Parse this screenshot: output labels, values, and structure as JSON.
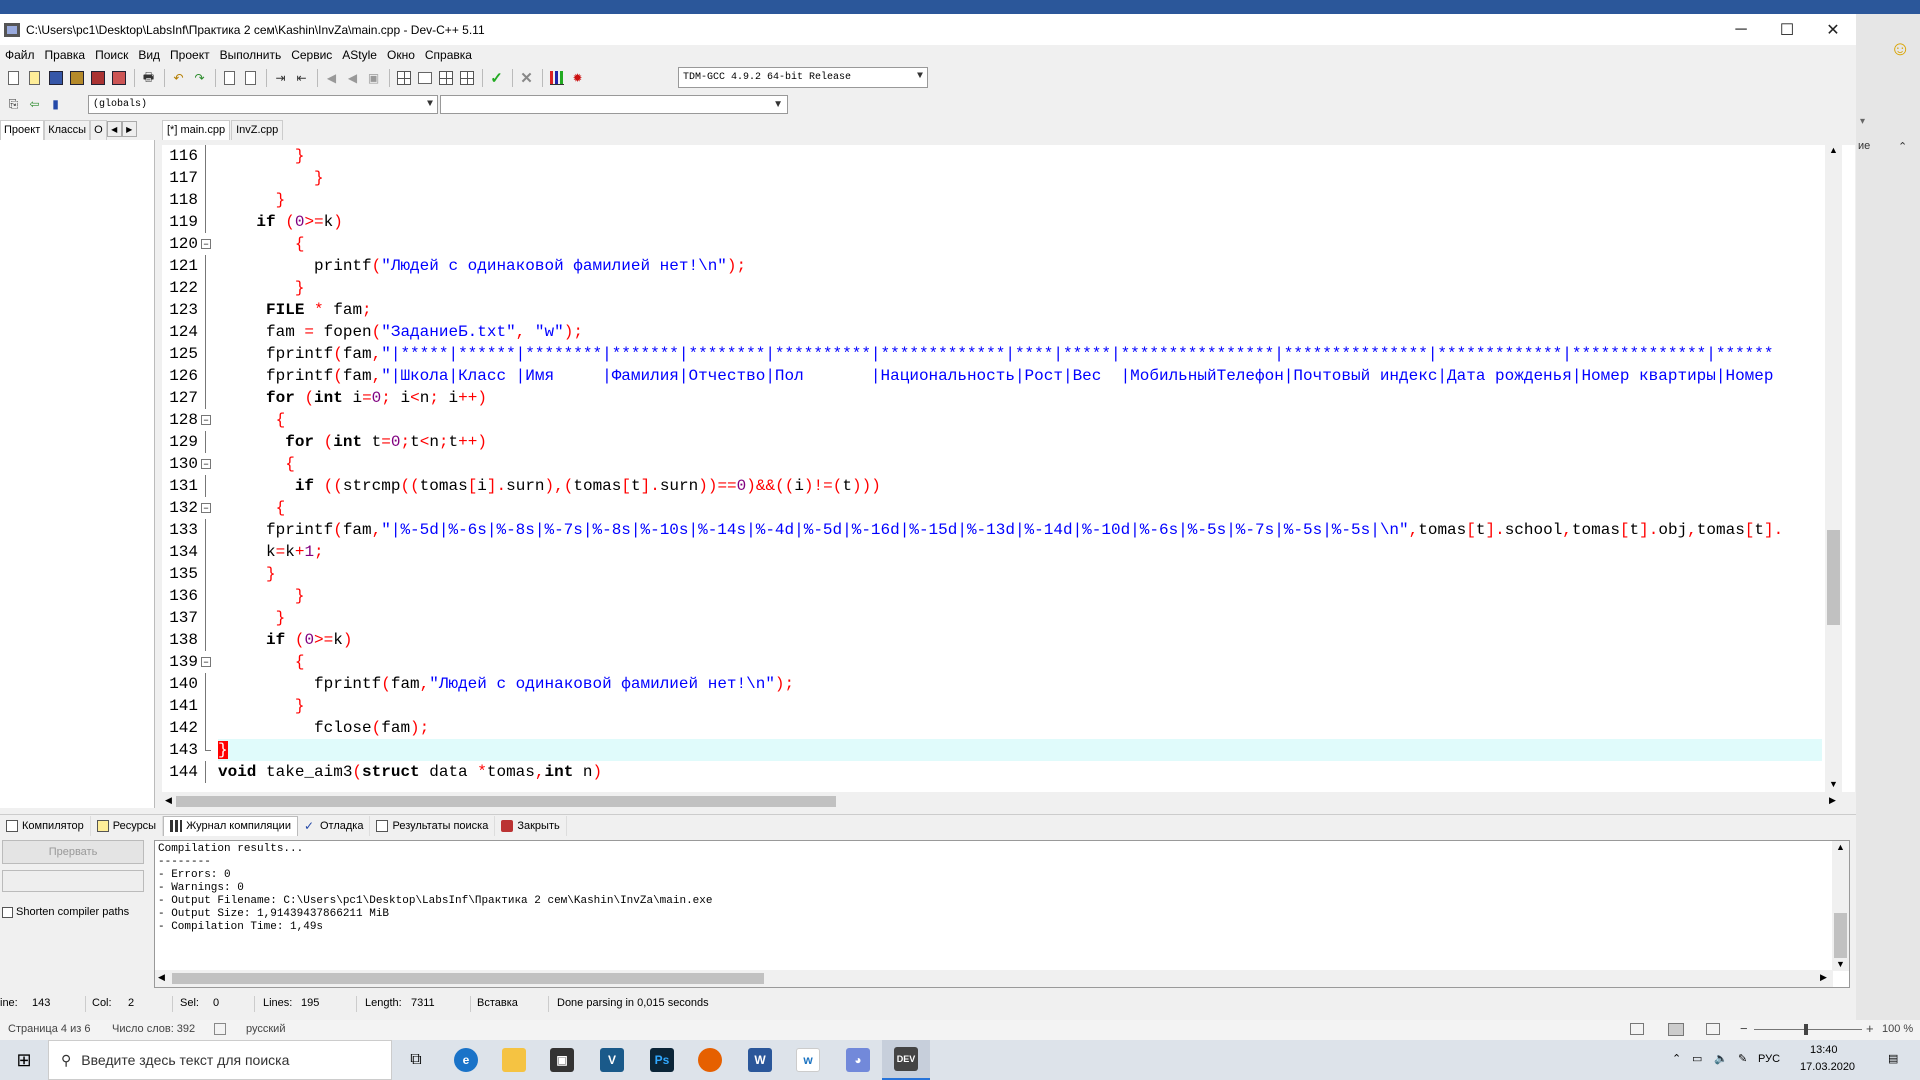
{
  "window": {
    "title": "C:\\Users\\pc1\\Desktop\\LabsInf\\Практика 2 сем\\Kashin\\InvZa\\main.cpp - Dev-C++ 5.11"
  },
  "menu": [
    "Файл",
    "Правка",
    "Поиск",
    "Вид",
    "Проект",
    "Выполнить",
    "Сервис",
    "AStyle",
    "Окно",
    "Справка"
  ],
  "toolbar": {
    "compiler_select": "TDM-GCC 4.9.2 64-bit Release",
    "scope_select": "(globals)",
    "member_select": ""
  },
  "left_tabs": [
    "Проект",
    "Классы",
    "О"
  ],
  "file_tabs": [
    "[*] main.cpp",
    "InvZ.cpp"
  ],
  "editor": {
    "lines": [
      {
        "num": "116",
        "text": "        }"
      },
      {
        "num": "117",
        "text": "          }"
      },
      {
        "num": "118",
        "text": "      }"
      },
      {
        "num": "119",
        "text": "    if (0>=k)"
      },
      {
        "num": "120",
        "text": "        {"
      },
      {
        "num": "121",
        "text": "          printf(\"Людей с одинаковой фамилией нет!\\n\");"
      },
      {
        "num": "122",
        "text": "        }"
      },
      {
        "num": "123",
        "text": "     FILE * fam;"
      },
      {
        "num": "124",
        "text": "     fam = fopen(\"ЗаданиеБ.txt\", \"w\");"
      },
      {
        "num": "125",
        "text": "     fprintf(fam,\"|*****|******|********|*******|********|**********|*************|****|*****|****************|***************|*************|**************|******"
      },
      {
        "num": "126",
        "text": "     fprintf(fam,\"|Школа|Класс |Имя     |Фамилия|Отчество|Пол       |Национальность|Рост|Вес  |МобильныйТелефон|Почтовый индекс|Дата рожденья|Номер квартиры|Номер"
      },
      {
        "num": "127",
        "text": "     for (int i=0; i<n; i++)"
      },
      {
        "num": "128",
        "text": "      {"
      },
      {
        "num": "129",
        "text": "       for (int t=0;t<n;t++)"
      },
      {
        "num": "130",
        "text": "       {"
      },
      {
        "num": "131",
        "text": "        if ((strcmp((tomas[i].surn),(tomas[t].surn))==0)&&((i)!=(t)))"
      },
      {
        "num": "132",
        "text": "      {"
      },
      {
        "num": "133",
        "text": "     fprintf(fam,\"|%-5d|%-6s|%-8s|%-7s|%-8s|%-10s|%-14s|%-4d|%-5d|%-16d|%-15d|%-13d|%-14d|%-10d|%-6s|%-5s|%-7s|%-5s|%-5s|\\n\",tomas[t].school,tomas[t].obj,tomas[t]."
      },
      {
        "num": "134",
        "text": "     k=k+1;"
      },
      {
        "num": "135",
        "text": "     }"
      },
      {
        "num": "136",
        "text": "        }"
      },
      {
        "num": "137",
        "text": "      }"
      },
      {
        "num": "138",
        "text": "     if (0>=k)"
      },
      {
        "num": "139",
        "text": "        {"
      },
      {
        "num": "140",
        "text": "          fprintf(fam,\"Людей с одинаковой фамилией нет!\\n\");"
      },
      {
        "num": "141",
        "text": "        }"
      },
      {
        "num": "142",
        "text": "          fclose(fam);"
      },
      {
        "num": "143",
        "text": "}"
      },
      {
        "num": "144",
        "text": "void take_aim3(struct data *tomas,int n)"
      }
    ]
  },
  "bottom_tabs": [
    "Компилятор",
    "Ресурсы",
    "Журнал компиляции",
    "Отладка",
    "Результаты поиска",
    "Закрыть"
  ],
  "compile_panel": {
    "stop_button": "Прервать",
    "shorten_label": "Shorten compiler paths",
    "log": "Compilation results...\n--------\n- Errors: 0\n- Warnings: 0\n- Output Filename: C:\\Users\\pc1\\Desktop\\LabsInf\\Практика 2 сем\\Kashin\\InvZa\\main.exe\n- Output Size: 1,91439437866211 MiB\n- Compilation Time: 1,49s"
  },
  "status": {
    "line_label": "ine:",
    "line": "143",
    "col_label": "Col:",
    "col": "2",
    "sel_label": "Sel:",
    "sel": "0",
    "lines_label": "Lines:",
    "lines": "195",
    "length_label": "Length:",
    "length": "7311",
    "mode": "Вставка",
    "parse": "Done parsing in 0,015 seconds"
  },
  "word_status": {
    "page": "Страница 4 из 6",
    "words": "Число слов: 392",
    "lang": "русский",
    "zoom": "100 %",
    "right_fragment": "ие"
  },
  "taskbar": {
    "search_placeholder": "Введите здесь текст для поиска",
    "lang": "РУС",
    "time": "13:40",
    "date": "17.03.2020"
  },
  "colors": {
    "keyword": "#000000",
    "string": "#0000ff",
    "symbol": "#ff0000",
    "number": "#800080",
    "current_line": "#e0fbfb"
  }
}
